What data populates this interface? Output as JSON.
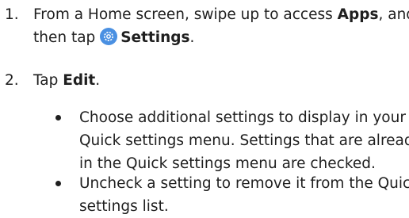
{
  "steps": [
    {
      "number": "1.",
      "line1_pre": "From a Home screen, swipe up to access ",
      "line1_bold": "Apps",
      "line1_post": ", and",
      "line2_pre": "then tap ",
      "line2_bold": "Settings",
      "line2_post": ".",
      "icon": "settings-gear-icon"
    },
    {
      "number": "2.",
      "text_pre": "Tap ",
      "text_bold": "Edit",
      "text_post": "."
    }
  ],
  "bullets": [
    {
      "lines": [
        "Choose additional settings to display in your",
        "Quick settings menu. Settings that are already",
        "in the Quick settings menu are checked."
      ]
    },
    {
      "lines": [
        "Uncheck a setting to remove it from the Quick",
        "settings list."
      ]
    }
  ]
}
